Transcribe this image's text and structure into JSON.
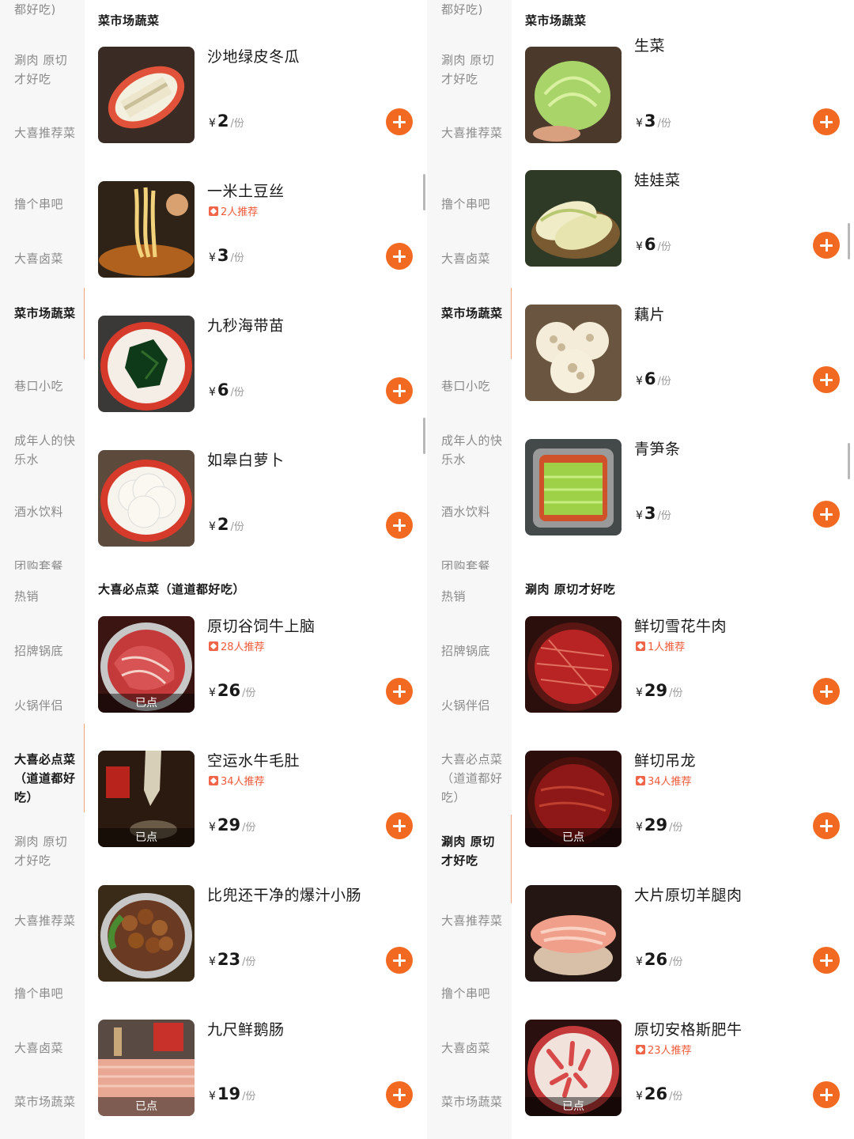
{
  "panels": [
    {
      "sidebar": [
        "都好吃)",
        "涮肉 原切才好吃",
        "大喜推荐菜",
        "撸个串吧",
        "大喜卤菜",
        "菜市场蔬菜",
        "巷口小吃",
        "成年人的快乐水",
        "酒水饮料",
        "团购套餐"
      ],
      "active_index": 5,
      "category": "菜市场蔬菜",
      "dishes": [
        {
          "name": "沙地绿皮冬瓜",
          "rec": "",
          "yen": "¥",
          "price": "2",
          "unit": "/份",
          "ordered": "",
          "img": "wintermelon-image"
        },
        {
          "name": "一米土豆丝",
          "rec": "2人推荐",
          "yen": "¥",
          "price": "3",
          "unit": "/份",
          "ordered": "",
          "img": "potato-image"
        },
        {
          "name": "九秒海带苗",
          "rec": "",
          "yen": "¥",
          "price": "6",
          "unit": "/份",
          "ordered": "",
          "img": "kelp-image"
        },
        {
          "name": "如皋白萝卜",
          "rec": "",
          "yen": "¥",
          "price": "2",
          "unit": "/份",
          "ordered": "",
          "img": "radish-image"
        }
      ]
    },
    {
      "sidebar": [
        "都好吃)",
        "涮肉 原切才好吃",
        "大喜推荐菜",
        "撸个串吧",
        "大喜卤菜",
        "菜市场蔬菜",
        "巷口小吃",
        "成年人的快乐水",
        "酒水饮料",
        "团购套餐"
      ],
      "active_index": 5,
      "category": "菜市场蔬菜",
      "dishes": [
        {
          "name": "生菜",
          "rec": "",
          "yen": "¥",
          "price": "3",
          "unit": "/份",
          "ordered": "",
          "img": "lettuce-image"
        },
        {
          "name": "娃娃菜",
          "rec": "",
          "yen": "¥",
          "price": "6",
          "unit": "/份",
          "ordered": "",
          "img": "baby-cabbage-image"
        },
        {
          "name": "藕片",
          "rec": "",
          "yen": "¥",
          "price": "6",
          "unit": "/份",
          "ordered": "",
          "img": "lotus-root-image"
        },
        {
          "name": "青笋条",
          "rec": "",
          "yen": "¥",
          "price": "3",
          "unit": "/份",
          "ordered": "",
          "img": "lettuce-stem-image"
        }
      ]
    },
    {
      "sidebar": [
        "热销",
        "招牌锅底",
        "火锅伴侣",
        "大喜必点菜（道道都好吃）",
        "涮肉 原切才好吃",
        "大喜推荐菜",
        "撸个串吧",
        "大喜卤菜",
        "菜市场蔬菜"
      ],
      "active_index": 3,
      "category": "大喜必点菜（道道都好吃）",
      "dishes": [
        {
          "name": "原切谷饲牛上脑",
          "rec": "28人推荐",
          "yen": "¥",
          "price": "26",
          "unit": "/份",
          "ordered": "已点",
          "img": "beef-chuck-image"
        },
        {
          "name": "空运水牛毛肚",
          "rec": "34人推荐",
          "yen": "¥",
          "price": "29",
          "unit": "/份",
          "ordered": "已点",
          "img": "tripe-image"
        },
        {
          "name": "比兜还干净的爆汁小肠",
          "rec": "",
          "yen": "¥",
          "price": "23",
          "unit": "/份",
          "ordered": "",
          "img": "intestine-image"
        },
        {
          "name": "九尺鲜鹅肠",
          "rec": "",
          "yen": "¥",
          "price": "19",
          "unit": "/份",
          "ordered": "已点",
          "img": "goose-intestine-image"
        }
      ]
    },
    {
      "sidebar": [
        "热销",
        "招牌锅底",
        "火锅伴侣",
        "大喜必点菜（道道都好吃）",
        "涮肉 原切才好吃",
        "大喜推荐菜",
        "撸个串吧",
        "大喜卤菜",
        "菜市场蔬菜"
      ],
      "active_index": 4,
      "category": "涮肉 原切才好吃",
      "dishes": [
        {
          "name": "鲜切雪花牛肉",
          "rec": "1人推荐",
          "yen": "¥",
          "price": "29",
          "unit": "/份",
          "ordered": "",
          "img": "marbled-beef-image"
        },
        {
          "name": "鲜切吊龙",
          "rec": "34人推荐",
          "yen": "¥",
          "price": "29",
          "unit": "/份",
          "ordered": "已点",
          "img": "sirloin-image"
        },
        {
          "name": "大片原切羊腿肉",
          "rec": "",
          "yen": "¥",
          "price": "26",
          "unit": "/份",
          "ordered": "",
          "img": "lamb-leg-image"
        },
        {
          "name": "原切安格斯肥牛",
          "rec": "23人推荐",
          "yen": "¥",
          "price": "26",
          "unit": "/份",
          "ordered": "已点",
          "img": "angus-beef-image"
        }
      ]
    }
  ]
}
